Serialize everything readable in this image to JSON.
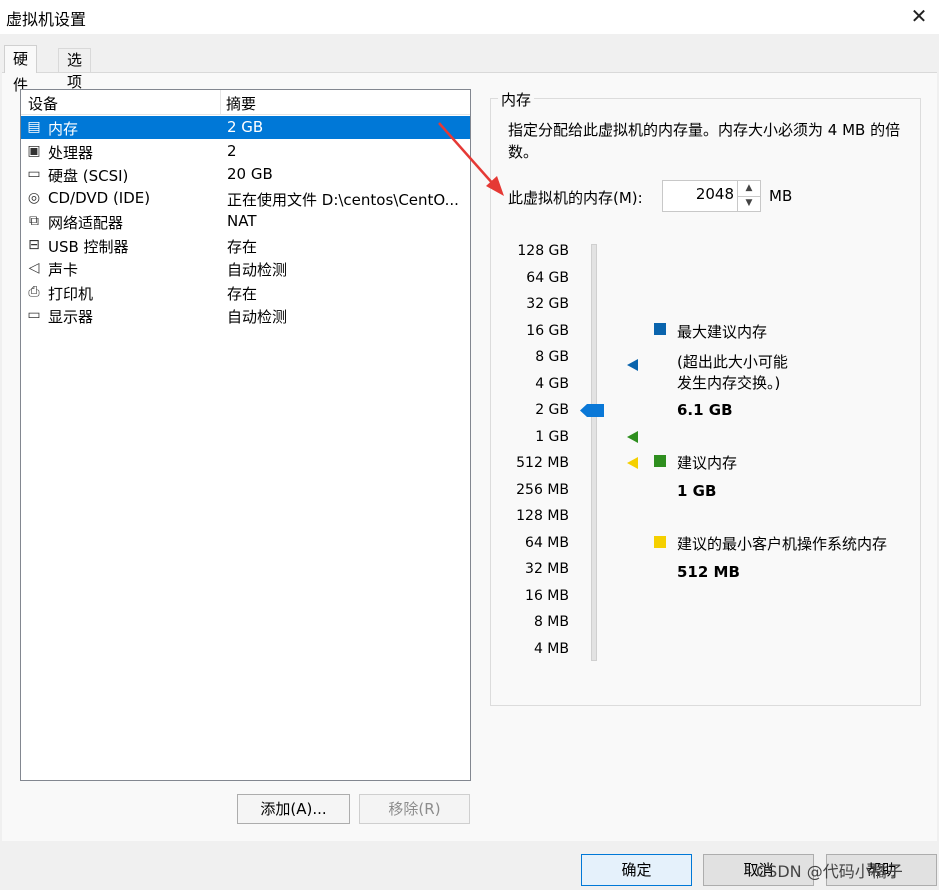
{
  "window": {
    "title": "虚拟机设置"
  },
  "tabs": [
    {
      "label": "硬件"
    },
    {
      "label": "选项"
    }
  ],
  "device_list": {
    "headers": {
      "device": "设备",
      "summary": "摘要"
    },
    "rows": [
      {
        "name": "内存",
        "summary": "2 GB",
        "icon": "memory-icon"
      },
      {
        "name": "处理器",
        "summary": "2",
        "icon": "processor-icon"
      },
      {
        "name": "硬盘 (SCSI)",
        "summary": "20 GB",
        "icon": "hard-disk-icon"
      },
      {
        "name": "CD/DVD (IDE)",
        "summary": "正在使用文件 D:\\centos\\CentO...",
        "icon": "cd-dvd-icon"
      },
      {
        "name": "网络适配器",
        "summary": "NAT",
        "icon": "network-adapter-icon"
      },
      {
        "name": "USB 控制器",
        "summary": "存在",
        "icon": "usb-icon"
      },
      {
        "name": "声卡",
        "summary": "自动检测",
        "icon": "sound-card-icon"
      },
      {
        "name": "打印机",
        "summary": "存在",
        "icon": "printer-icon"
      },
      {
        "name": "显示器",
        "summary": "自动检测",
        "icon": "display-icon"
      }
    ],
    "selected_index": 0
  },
  "list_buttons": {
    "add": "添加(A)...",
    "remove": "移除(R)"
  },
  "memory": {
    "group_title": "内存",
    "description": "指定分配给此虚拟机的内存量。内存大小必须为 4 MB 的倍数。",
    "field_label": "此虚拟机的内存(M):",
    "value": "2048",
    "unit": "MB",
    "scale_labels": [
      "128 GB",
      "64 GB",
      "32 GB",
      "16 GB",
      "8 GB",
      "4 GB",
      "2 GB",
      "1 GB",
      "512 MB",
      "256 MB",
      "128 MB",
      "64 MB",
      "32 MB",
      "16 MB",
      "8 MB",
      "4 MB"
    ],
    "legend": {
      "max": {
        "title": "最大建议内存",
        "note_line1": "(超出此大小可能",
        "note_line2": "发生内存交换。)",
        "value": "6.1 GB",
        "color": "#0a64ad"
      },
      "recommended": {
        "title": "建议内存",
        "value": "1 GB",
        "color": "#2f8f1f"
      },
      "min_guest": {
        "title": "建议的最小客户机操作系统内存",
        "value": "512 MB",
        "color": "#f5d000"
      }
    }
  },
  "footer": {
    "ok": "确定",
    "cancel": "取消",
    "help": "帮助",
    "watermark": "CSDN @代码小橘子"
  },
  "colors": {
    "selection": "#0078d7",
    "annotation_arrow": "#e53935"
  }
}
